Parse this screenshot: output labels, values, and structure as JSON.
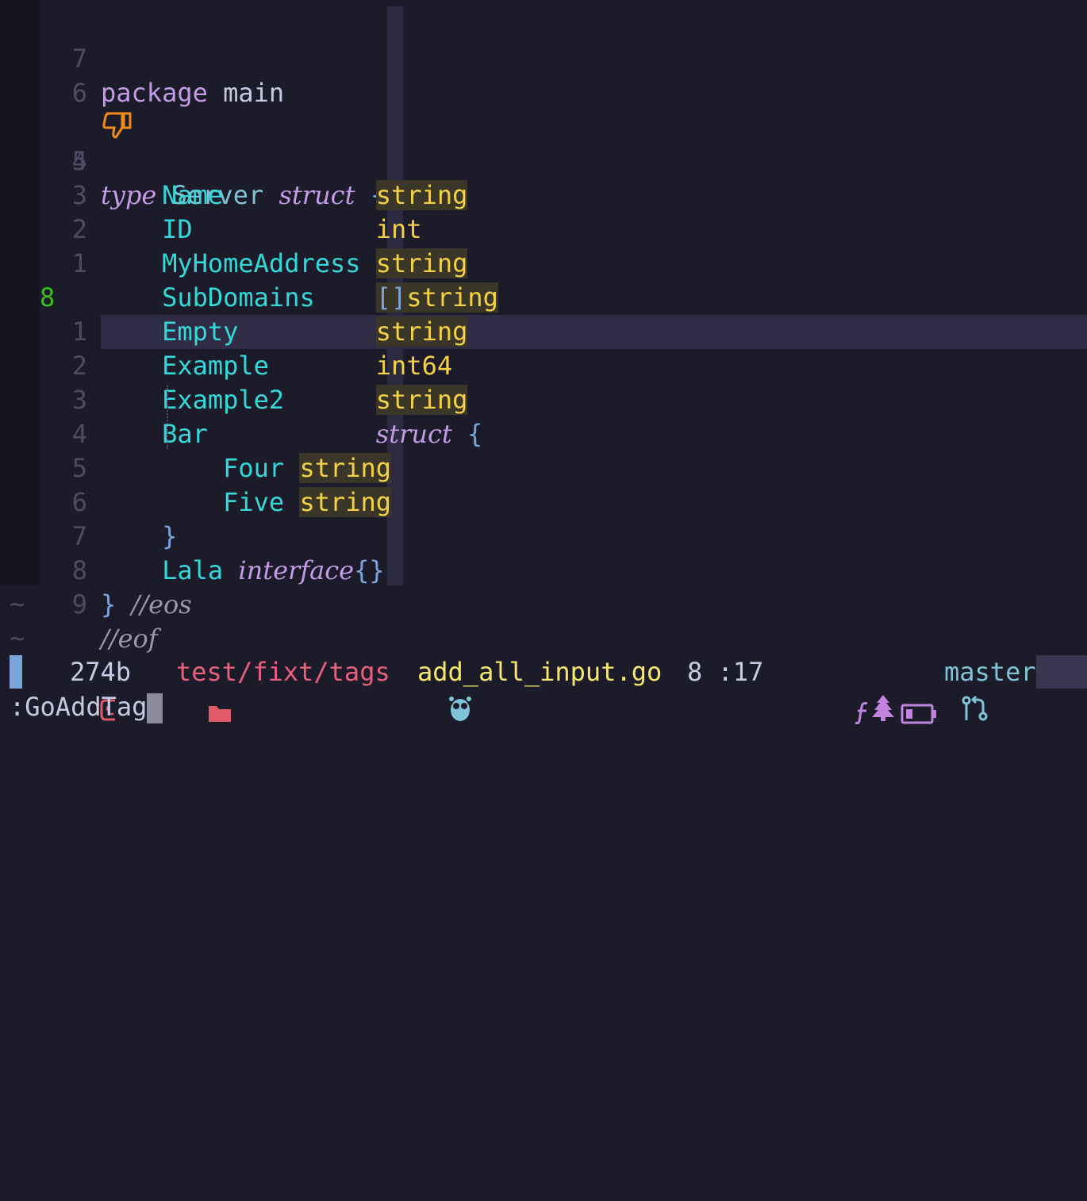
{
  "editor": {
    "lines": [
      {
        "rel": "7"
      },
      {
        "rel": "6"
      },
      {
        "rel": "5"
      },
      {
        "rel": "4"
      },
      {
        "rel": "3"
      },
      {
        "rel": "2"
      },
      {
        "rel": "1"
      },
      {
        "rel": "8"
      },
      {
        "rel": "1"
      },
      {
        "rel": "2"
      },
      {
        "rel": "3"
      },
      {
        "rel": "4"
      },
      {
        "rel": "5"
      },
      {
        "rel": "6"
      },
      {
        "rel": "7"
      },
      {
        "rel": "8"
      },
      {
        "rel": "9"
      }
    ],
    "tokens": {
      "package_kw": "package",
      "package_name": "main",
      "type_kw": "type",
      "struct_name": "Server",
      "struct_kw": "struct",
      "open_brace": "{",
      "f_name": "Name",
      "t_name": "string",
      "f_id": "ID",
      "t_id": "int",
      "f_addr": "MyHomeAddress",
      "t_addr": "string",
      "f_sub": "SubDomains",
      "t_sub_br": "[]",
      "t_sub": "string",
      "f_empty": "Empty",
      "t_empty": "string",
      "f_ex": "Example",
      "t_ex": "int64",
      "f_ex2": "Example2",
      "t_ex2": "string",
      "f_bar": "Bar",
      "t_bar": "struct",
      "bar_brace": "{",
      "f_four": "Four",
      "t_four": "string",
      "f_five": "Five",
      "t_five": "string",
      "bar_close": "}",
      "f_lala": "Lala",
      "t_lala": "interface",
      "lala_braces": "{}",
      "close_brace": "}",
      "comment_eos": "//eos",
      "comment_eof": "//eof"
    },
    "tilde": "~"
  },
  "statusbar": {
    "size": "274b",
    "path": "test/fixt/tags",
    "filename": "add_all_input.go",
    "position": "8 :17",
    "branch": "master"
  },
  "cmdline": {
    "text": ":GoAddTag"
  },
  "colors": {
    "accent": "#7aa4dc",
    "current_line_nr": "#35c21d",
    "sign": "#f08c1e"
  }
}
